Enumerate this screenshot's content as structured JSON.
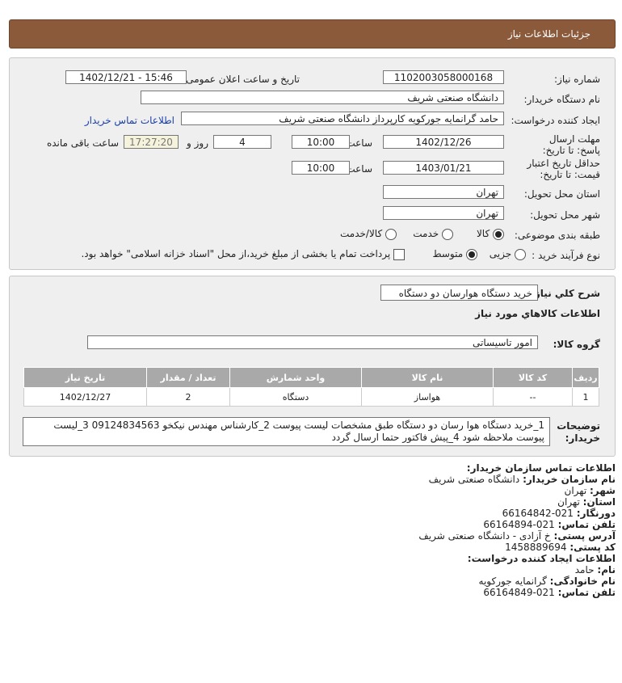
{
  "header": {
    "title": "جزئیات اطلاعات نیاز"
  },
  "form": {
    "need_number_label": "شماره نیاز:",
    "need_number": "1102003058000168",
    "announce_label": "تاریخ و ساعت اعلان عمومی:",
    "announce_value": "1402/12/21 - 15:46",
    "buyer_org_label": "نام دستگاه خریدار:",
    "buyer_org": "دانشگاه صنعتی شریف",
    "creator_label": "ایجاد کننده درخواست:",
    "creator": "حامد گرانمایه جورکویه کارپرداز دانشگاه صنعتی شریف",
    "contact_link": "اطلاعات تماس خریدار",
    "deadline_label": "مهلت ارسال پاسخ: تا تاریخ:",
    "deadline_date": "1402/12/26",
    "time_label": "ساعت",
    "deadline_time": "10:00",
    "days_value": "4",
    "days_label": "روز و",
    "remaining_time": "17:27:20",
    "remaining_label": "ساعت باقی مانده",
    "validity_label": "حداقل تاریخ اعتبار قیمت: تا تاریخ:",
    "validity_date": "1403/01/21",
    "validity_time": "10:00",
    "province_label": "استان محل تحویل:",
    "province": "تهران",
    "city_label": "شهر محل تحویل:",
    "city": "تهران",
    "category_label": "طبقه بندی موضوعی:",
    "category_options": [
      "کالا",
      "خدمت",
      "کالا/خدمت"
    ],
    "purchase_type_label": "نوع فرآیند خرید :",
    "purchase_options": [
      "جزیی",
      "متوسط"
    ],
    "payment_note": "پرداخت تمام یا بخشی از مبلغ خرید،از محل \"اسناد خزانه اسلامی\" خواهد بود."
  },
  "description": {
    "label": "شرح كلي نياز:",
    "value": "خرید دستگاه هوارسان دو دستگاه",
    "goods_info_label": "اطلاعات كالاهاي مورد نياز",
    "group_label": "گروه کالا:",
    "group_value": "امور تاسیساتی"
  },
  "table": {
    "headers": [
      "ردیف",
      "کد کالا",
      "نام کالا",
      "واحد شمارش",
      "تعداد / مقدار",
      "تاریخ نیاز"
    ],
    "rows": [
      [
        "1",
        "--",
        "هواساز",
        "دستگاه",
        "2",
        "1402/12/27"
      ]
    ]
  },
  "buyer_notes": {
    "label": "توضیحات خریدار:",
    "text": "1_خرید دستگاه هوا رسان دو دستگاه طبق مشخصات لیست پیوست 2_کارشناس مهندس نیکخو 09124834563 3_لیست پیوست ملاحظه شود 4_پیش فاکتور حتما ارسال گردد"
  },
  "contact_info": {
    "title": "اطلاعات تماس سازمان خریدار:",
    "lines": [
      {
        "label": "نام سازمان خریدار:",
        "value": "دانشگاه صنعتی شریف"
      },
      {
        "label": "شهر:",
        "value": "تهران"
      },
      {
        "label": "استان:",
        "value": "تهران"
      },
      {
        "label": "دورنگار:",
        "value": "021-66164842"
      },
      {
        "label": "تلفن تماس:",
        "value": "021-66164894"
      },
      {
        "label": "آدرس پستی:",
        "value": "خ آزادی - دانشگاه صنعتی شریف"
      },
      {
        "label": "کد پستی:",
        "value": "1458889694"
      }
    ],
    "creator_title": "اطلاعات ایجاد کننده درخواست:",
    "creator_lines": [
      {
        "label": "نام:",
        "value": "حامد"
      },
      {
        "label": "نام خانوادگی:",
        "value": "گرانمایه جورکویه"
      },
      {
        "label": "تلفن تماس:",
        "value": "021-66164849"
      }
    ]
  }
}
